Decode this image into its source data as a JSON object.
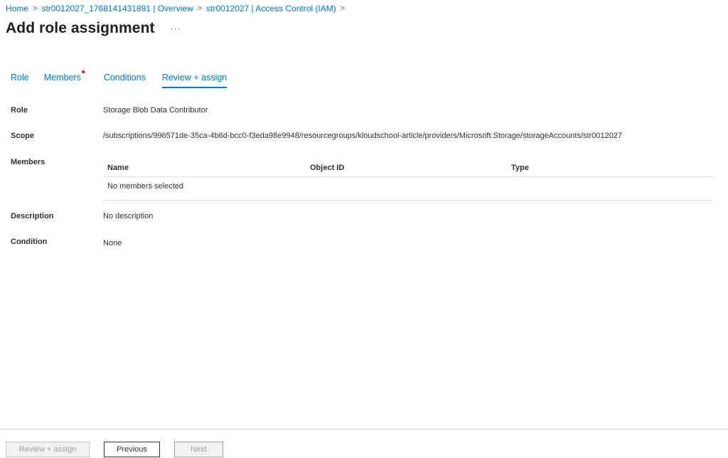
{
  "breadcrumb": {
    "items": [
      "Home",
      "str0012027_1768141431891 | Overview",
      "str0012027 | Access Control (IAM)"
    ],
    "separator": ">"
  },
  "page": {
    "title": "Add role assignment",
    "more": "···"
  },
  "tabs": [
    {
      "label": "Role"
    },
    {
      "label": "Members"
    },
    {
      "label": "Conditions"
    },
    {
      "label": "Review + assign"
    }
  ],
  "details": {
    "role_label": "Role",
    "role_value": "Storage Blob Data Contributor",
    "scope_label": "Scope",
    "scope_value": "/subscriptions/996571de-35ca-4b6d-bcc0-f3eda98e9948/resourcegroups/kloudschool-article/providers/Microsoft.Storage/storageAccounts/str0012027",
    "members_label": "Members",
    "description_label": "Description",
    "description_value": "No description",
    "condition_label": "Condition",
    "condition_value": "None"
  },
  "members_table": {
    "columns": [
      "Name",
      "Object ID",
      "Type"
    ],
    "empty_text": "No members selected"
  },
  "footer": {
    "review_assign": "Review + assign",
    "previous": "Previous",
    "next": "Next"
  },
  "colors": {
    "accent": "#0078d4",
    "required_dot": "#e81123",
    "border": "#e1dfdd"
  }
}
